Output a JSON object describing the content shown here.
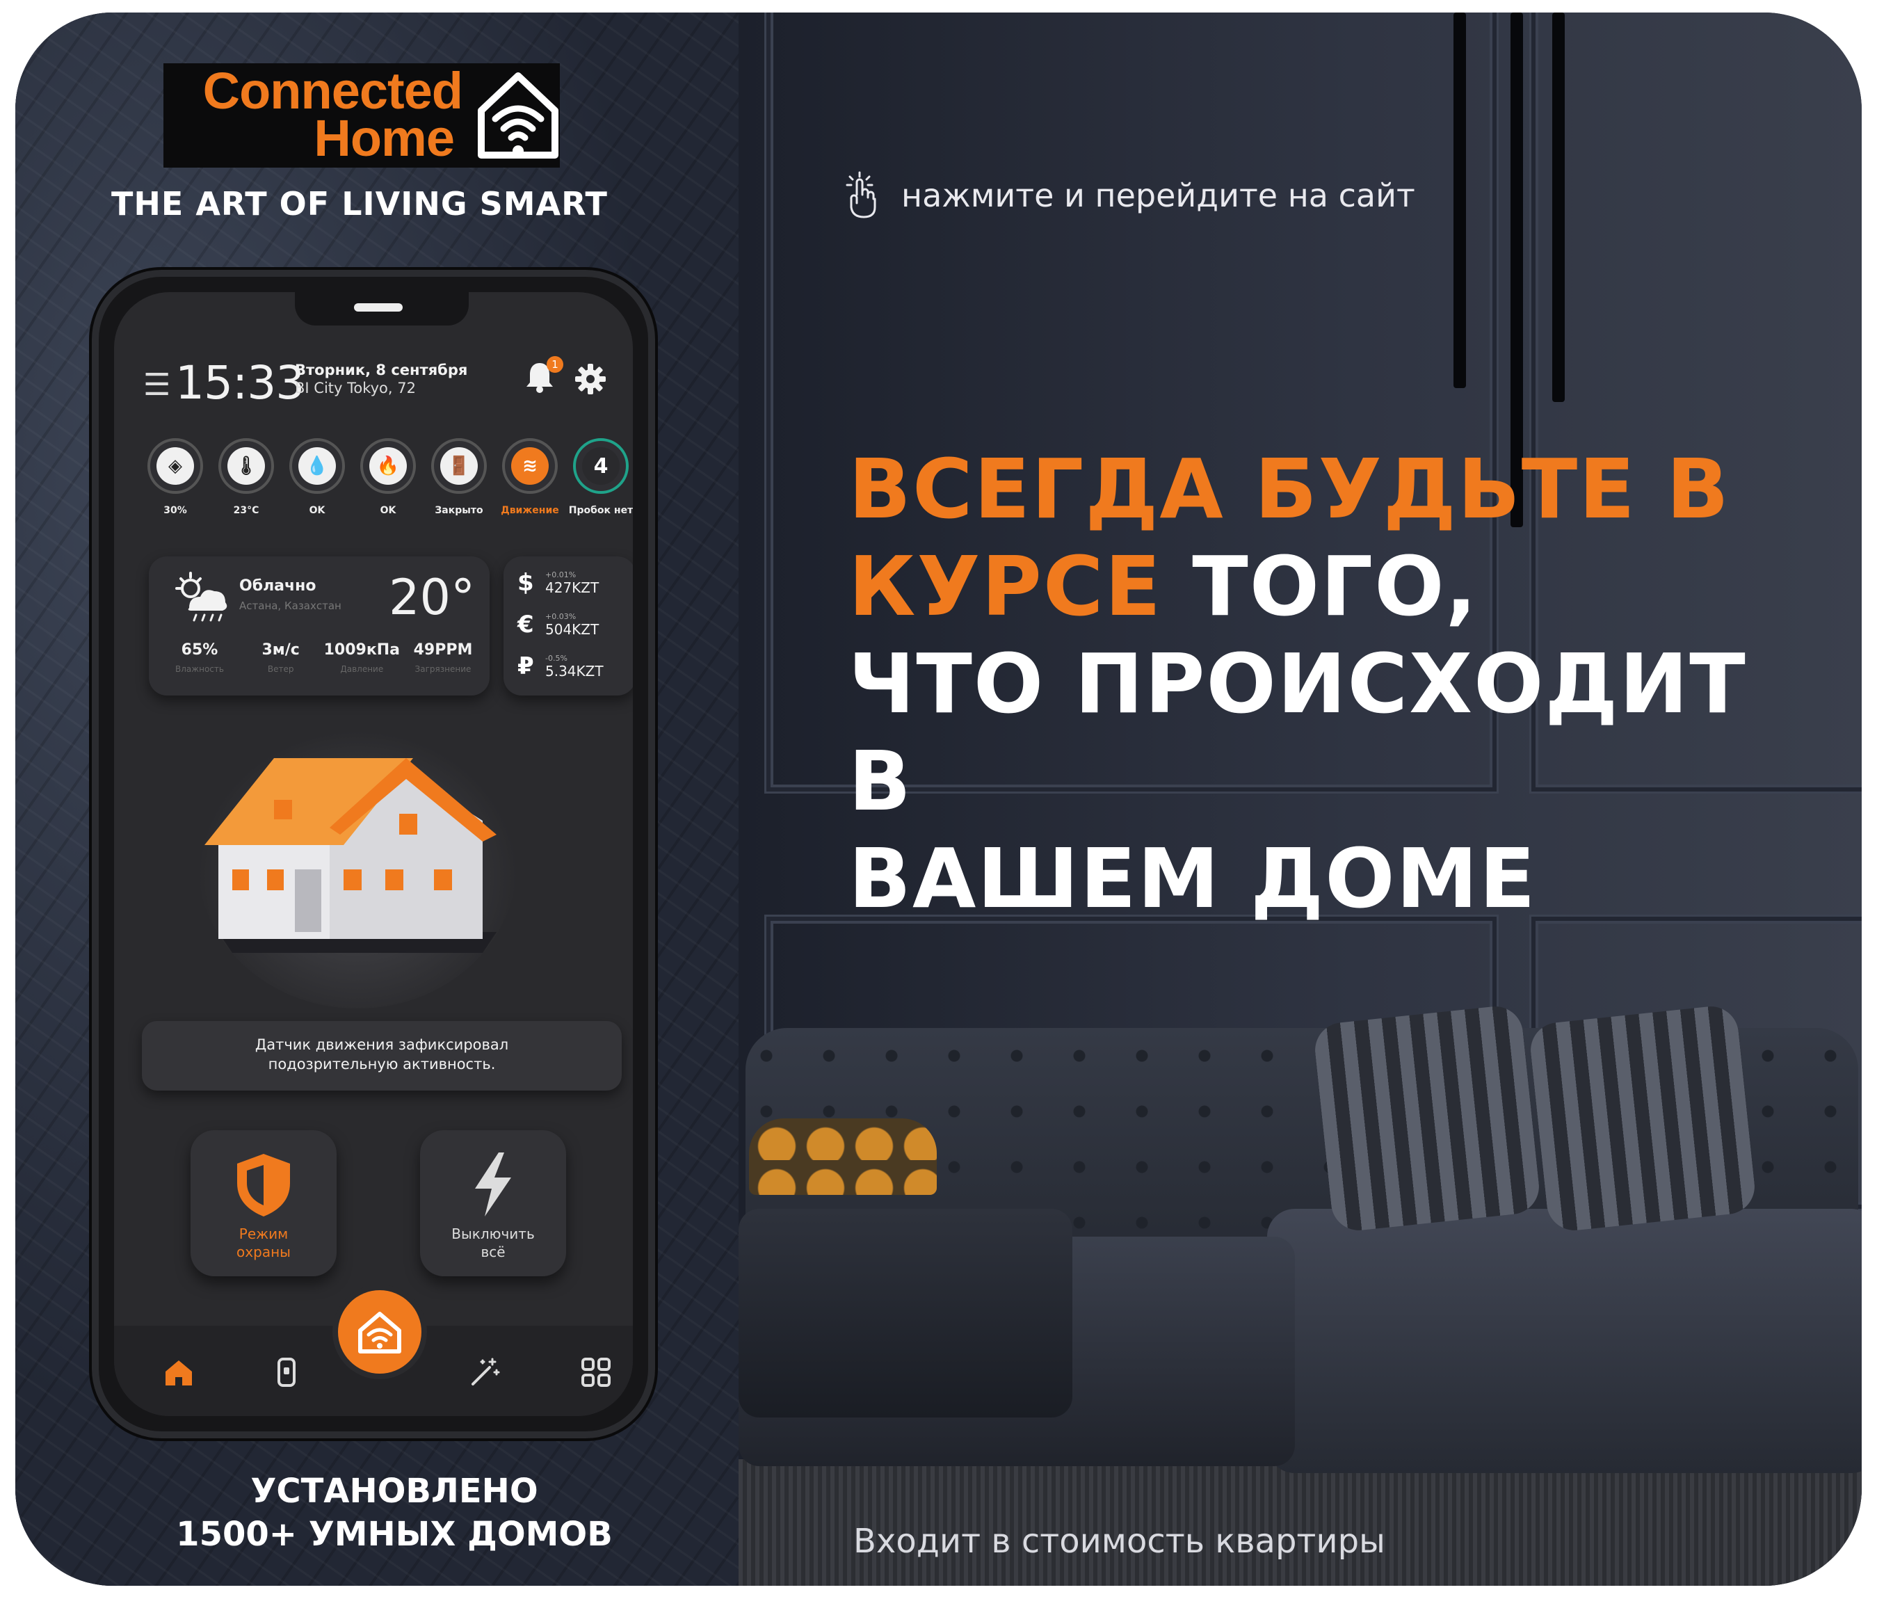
{
  "brand": {
    "logo_line1": "Connected",
    "logo_line2": "Home",
    "tagline": "THE ART OF LIVING SMART",
    "accent_color": "#f07a1e"
  },
  "hint": {
    "icon": "tap-hand-icon",
    "text": "нажмите и перейдите на сайт"
  },
  "headline": {
    "orange_part1": "ВСЕГДА БУДЬТЕ В",
    "orange_part2": "КУРСЕ",
    "white_part1": " ТОГО,",
    "white_part2": "ЧТО ПРОИСХОДИТ В",
    "white_part3": "ВАШЕМ ДОМЕ"
  },
  "footer": {
    "installed_line1": "УСТАНОВЛЕНО",
    "installed_line2": "1500+ УМНЫХ ДОМОВ",
    "included": "Входит в стоимость квартиры"
  },
  "app": {
    "time": "15:33",
    "date": "Вторник, 8 сентября",
    "address": "BI City Tokyo, 72",
    "notifications": "1",
    "sensors": [
      {
        "icon": "leak-icon",
        "label": "30%"
      },
      {
        "icon": "thermometer-icon",
        "label": "23°C"
      },
      {
        "icon": "water-drop-icon",
        "label": "OK"
      },
      {
        "icon": "fire-icon",
        "label": "OK"
      },
      {
        "icon": "door-icon",
        "label": "Закрыто"
      },
      {
        "icon": "motion-icon",
        "label": "Движение"
      },
      {
        "icon": "traffic-icon",
        "value": "4",
        "label": "Пробок нет"
      }
    ],
    "weather": {
      "condition": "Облачно",
      "city": "Астана, Казахстан",
      "temperature": "20°",
      "stats": [
        {
          "value": "65%",
          "label": "Влажность"
        },
        {
          "value": "3м/с",
          "label": "Ветер"
        },
        {
          "value": "1009кПа",
          "label": "Давление"
        },
        {
          "value": "49PPM",
          "label": "Загрязнение"
        }
      ]
    },
    "currencies": [
      {
        "symbol": "$",
        "delta": "+0.01%",
        "rate": "427KZT"
      },
      {
        "symbol": "€",
        "delta": "+0.03%",
        "rate": "504KZT"
      },
      {
        "symbol": "₽",
        "delta": "-0.5%",
        "rate": "5.34KZT"
      }
    ],
    "notice": {
      "line1": "Датчик движения зафиксировал",
      "line2": "подозрительную активность."
    },
    "actions": [
      {
        "line1": "Режим",
        "line2": "охраны",
        "color": "#f07a1e"
      },
      {
        "line1": "Выключить",
        "line2": "всё",
        "color": "#dddddd"
      }
    ]
  }
}
